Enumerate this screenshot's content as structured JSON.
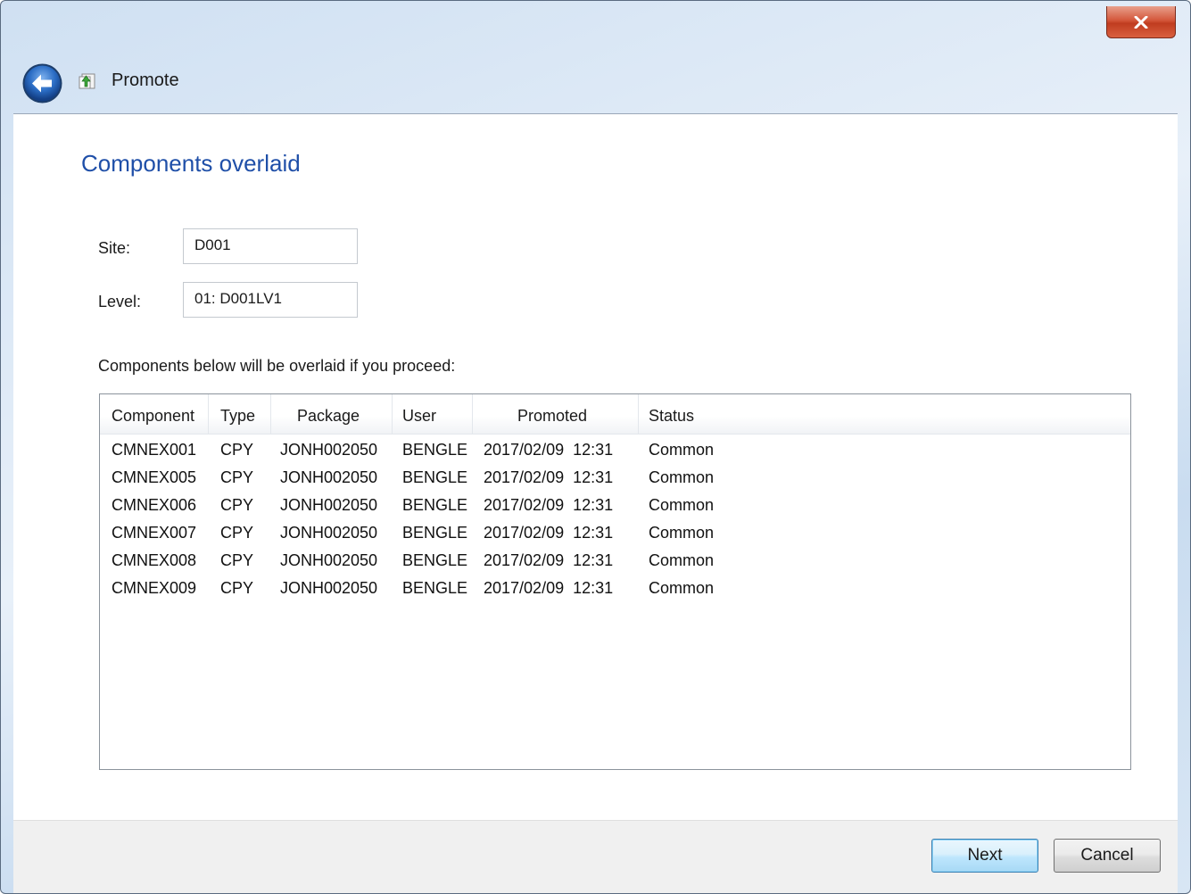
{
  "window": {
    "title": "Promote",
    "close_label": "x",
    "icons": {
      "back": "back-arrow-icon",
      "app": "promote-icon",
      "close": "close-icon"
    }
  },
  "page": {
    "heading": "Components overlaid",
    "site_label": "Site:",
    "site_value": "D001",
    "level_label": "Level:",
    "level_value": "01: D001LV1",
    "instruction": "Components below will be overlaid if you proceed:"
  },
  "table": {
    "columns": [
      "Component",
      "Type",
      "Package",
      "User",
      "Promoted",
      "Status"
    ],
    "rows": [
      [
        "CMNEX001",
        "CPY",
        "JONH002050",
        "BENGLE",
        "2017/02/09  12:31",
        "Common"
      ],
      [
        "CMNEX005",
        "CPY",
        "JONH002050",
        "BENGLE",
        "2017/02/09  12:31",
        "Common"
      ],
      [
        "CMNEX006",
        "CPY",
        "JONH002050",
        "BENGLE",
        "2017/02/09  12:31",
        "Common"
      ],
      [
        "CMNEX007",
        "CPY",
        "JONH002050",
        "BENGLE",
        "2017/02/09  12:31",
        "Common"
      ],
      [
        "CMNEX008",
        "CPY",
        "JONH002050",
        "BENGLE",
        "2017/02/09  12:31",
        "Common"
      ],
      [
        "CMNEX009",
        "CPY",
        "JONH002050",
        "BENGLE",
        "2017/02/09  12:31",
        "Common"
      ]
    ]
  },
  "buttons": {
    "next": "Next",
    "cancel": "Cancel"
  },
  "colors": {
    "heading": "#1f4fa8",
    "close": "#c03c1f",
    "back": "#2a6cc4"
  }
}
